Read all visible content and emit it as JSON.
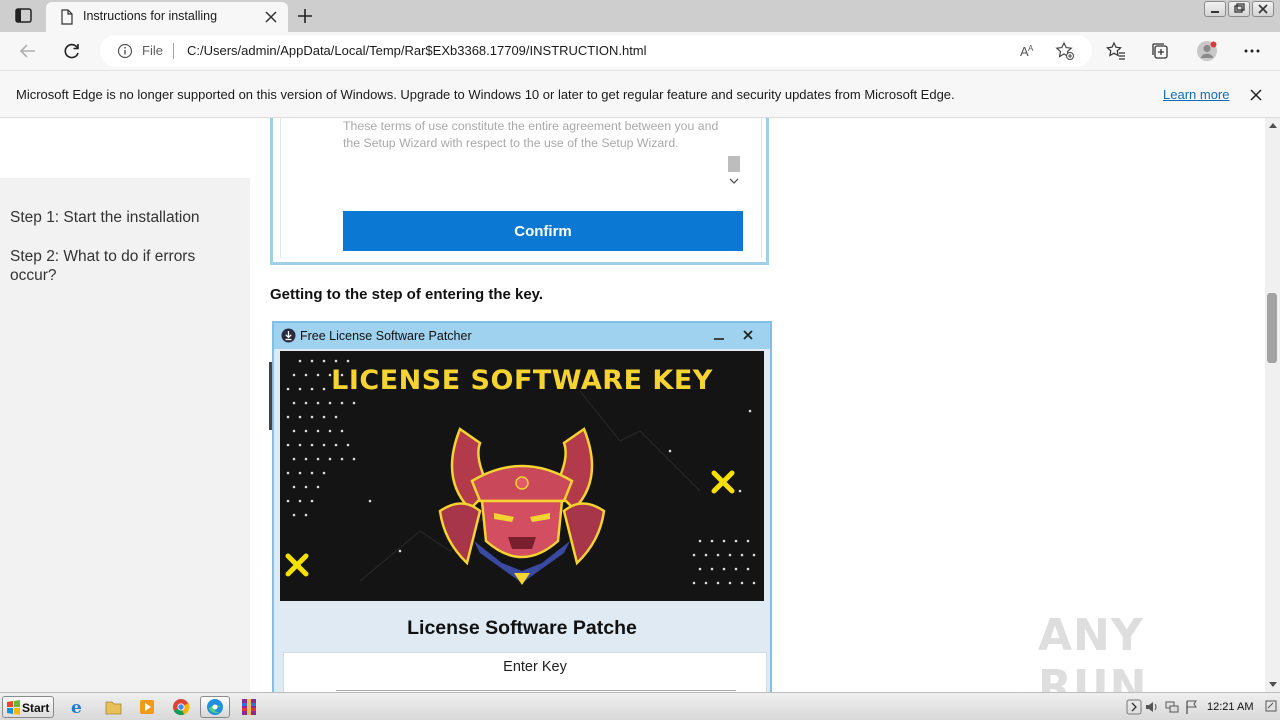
{
  "browser": {
    "tab_title": "Instructions for installing",
    "address_scheme": "File",
    "url": "C:/Users/admin/AppData/Local/Temp/Rar$EXb3368.17709/INSTRUCTION.html"
  },
  "infobar": {
    "message": "Microsoft Edge is no longer supported on this version of Windows. Upgrade to Windows 10 or later to get regular feature and security updates from Microsoft Edge.",
    "link": "Learn more"
  },
  "sidebar": {
    "steps": [
      "Step 1: Start the installation",
      "Step 2: What to do if errors occur?"
    ]
  },
  "setup": {
    "terms_text": "These terms of use constitute the entire agreement between you and the Setup Wizard with respect to the use of the Setup Wizard.",
    "confirm_label": "Confirm"
  },
  "caption": "Getting to the step of entering the key.",
  "dialog": {
    "title": "Free License Software Patcher",
    "banner_headline": "LICENSE SOFTWARE KEY",
    "heading": "License Software Patche",
    "key_label": "Enter Key"
  },
  "watermark": "ANY RUN",
  "taskbar": {
    "start_label": "Start",
    "clock": "12:21 AM"
  },
  "colors": {
    "accent": "#0b78d4",
    "dialog_border": "#7fc0e8",
    "banner_yellow": "#f5d330"
  }
}
